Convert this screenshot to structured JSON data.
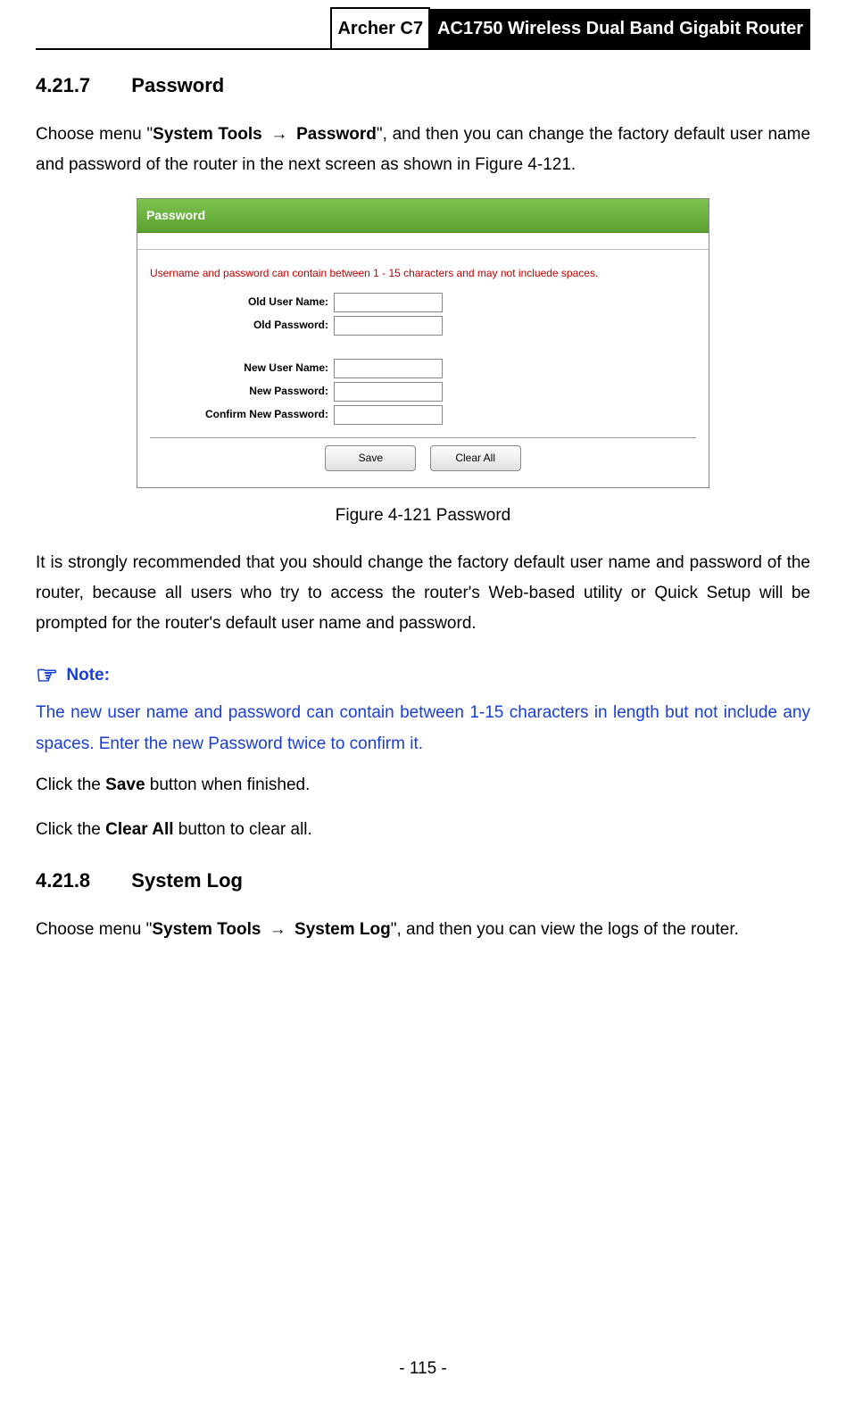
{
  "header": {
    "model": "Archer C7",
    "description": "AC1750 Wireless Dual Band Gigabit Router"
  },
  "sections": {
    "password": {
      "number": "4.21.7",
      "title": "Password",
      "intro_prefix": "Choose menu \"",
      "nav_part1": "System Tools",
      "nav_arrow": "→",
      "nav_part2": "Password",
      "intro_suffix": "\", and then you can change the factory default user name and password of the router in the next screen as shown in Figure 4-121.",
      "recommend_para": "It is strongly recommended that you should change the factory default user name and password of the router, because all users who try to access the router's Web-based utility or Quick Setup will be prompted for the router's default user name and password.",
      "save_line_prefix": "Click the ",
      "save_bold": "Save",
      "save_line_suffix": " button when finished.",
      "clear_line_prefix": "Click the ",
      "clear_bold": "Clear All",
      "clear_line_suffix": " button to clear all."
    },
    "syslog": {
      "number": "4.21.8",
      "title": "System Log",
      "intro_prefix": "Choose menu \"",
      "nav_part1": "System Tools",
      "nav_arrow": "→",
      "nav_part2": "System Log",
      "intro_suffix": "\", and then you can view the logs of the router."
    }
  },
  "figure": {
    "panel_title": "Password",
    "warning": "Username and password can contain between 1 - 15 characters and may not incluede spaces.",
    "labels": {
      "old_user": "Old User Name:",
      "old_pass": "Old Password:",
      "new_user": "New User Name:",
      "new_pass": "New Password:",
      "confirm_pass": "Confirm New Password:"
    },
    "buttons": {
      "save": "Save",
      "clear": "Clear All"
    },
    "caption": "Figure 4-121 Password"
  },
  "note": {
    "label": "Note:",
    "body": "The new user name and password can contain between 1-15 characters in length but not include any spaces. Enter the new Password twice to confirm it."
  },
  "footer": {
    "page_number": "- 115 -"
  }
}
